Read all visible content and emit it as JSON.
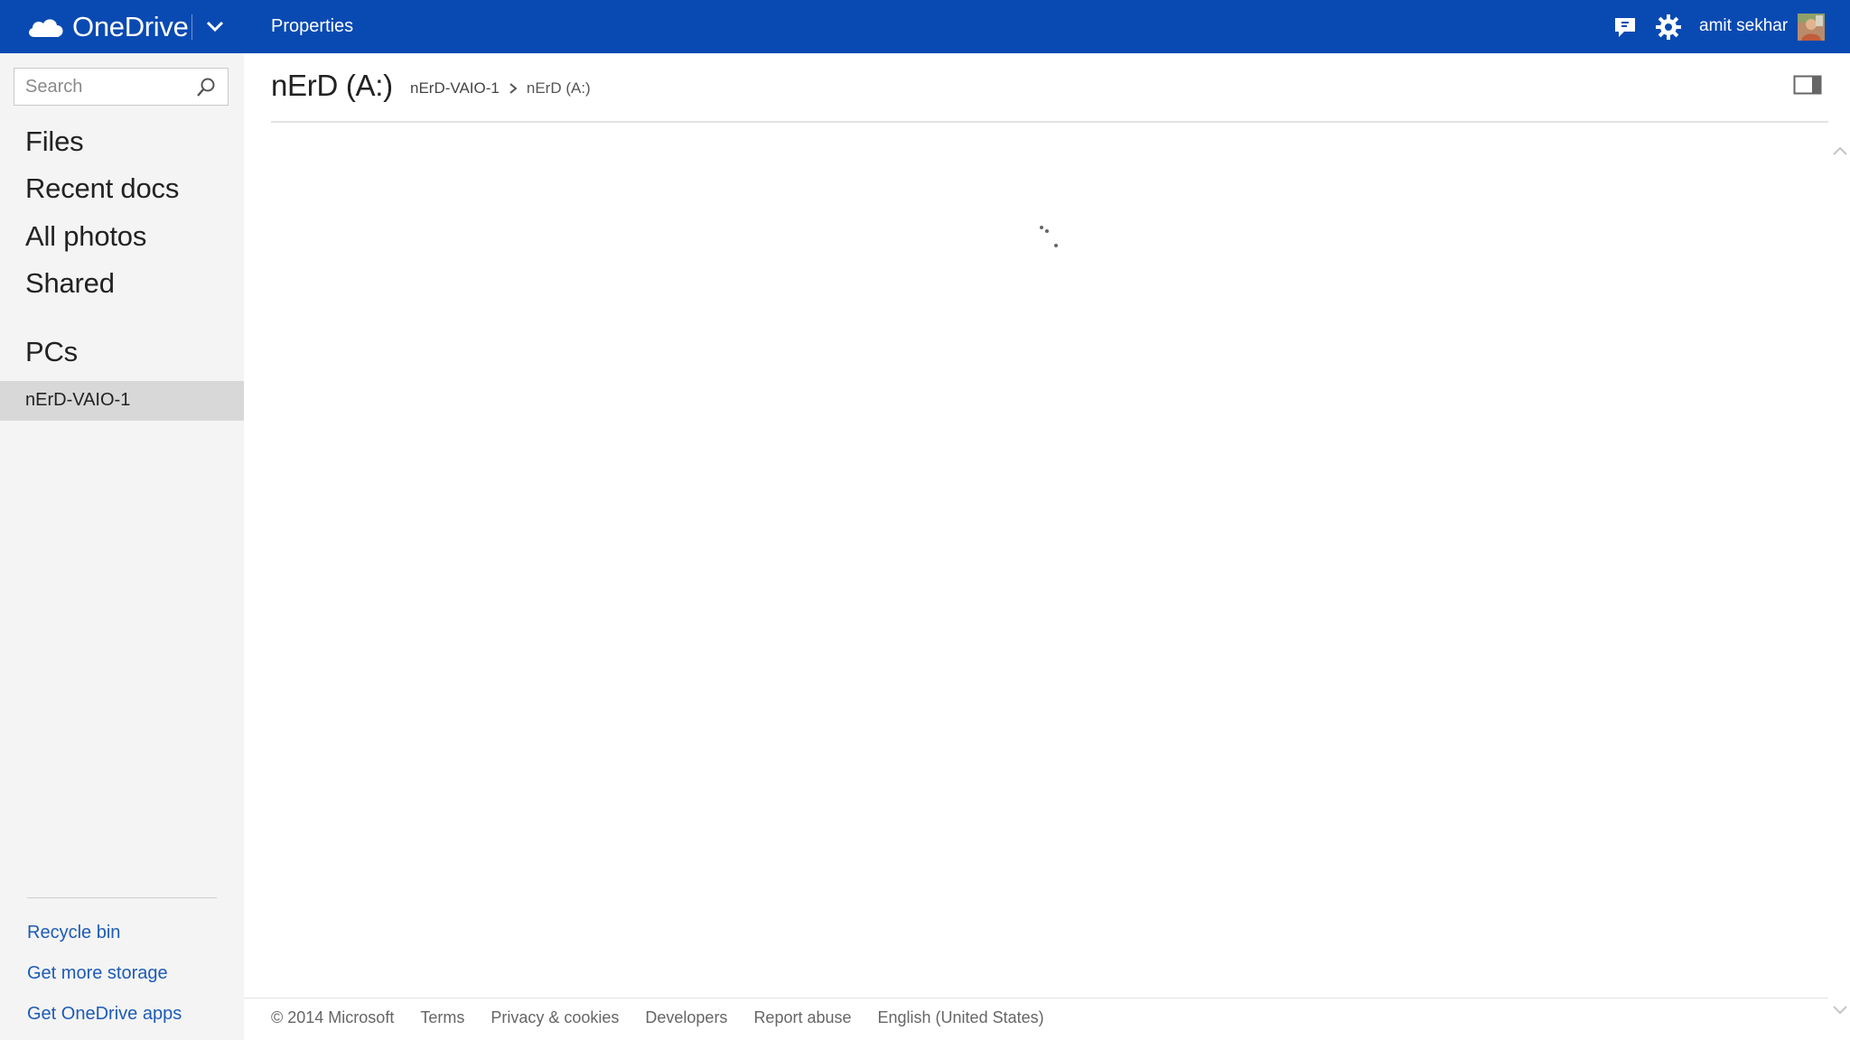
{
  "topbar": {
    "brand": "OneDrive",
    "command": "Properties",
    "user_name": "amit sekhar",
    "icons": [
      "cloud-logo-icon",
      "chevron-down-icon",
      "feedback-icon",
      "gear-icon",
      "avatar"
    ],
    "colors": {
      "bar": "#094ab2",
      "text": "#ffffff"
    }
  },
  "sidebar": {
    "search_placeholder": "Search",
    "nav": [
      "Files",
      "Recent docs",
      "All photos",
      "Shared"
    ],
    "pcs_heading": "PCs",
    "pcs": [
      "nErD-VAIO-1"
    ],
    "bottom_links": [
      "Recycle bin",
      "Get more storage",
      "Get OneDrive apps"
    ],
    "colors": {
      "background": "#f4f4f4",
      "selected": "#d8d8d8",
      "link": "#1d5bb5"
    }
  },
  "main": {
    "title": "nErD (A:)",
    "breadcrumb": [
      "nErD-VAIO-1",
      "nErD (A:)"
    ]
  },
  "footer": {
    "copyright": "© 2014 Microsoft",
    "links": [
      "Terms",
      "Privacy & cookies",
      "Developers",
      "Report abuse",
      "English (United States)"
    ]
  }
}
